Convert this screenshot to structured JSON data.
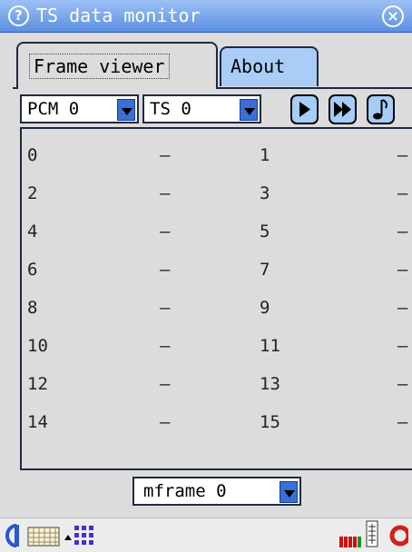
{
  "window": {
    "title": "TS data monitor",
    "help_icon": "help-circle-icon",
    "close_icon": "close-circle-icon"
  },
  "tabs": [
    {
      "label": "Frame viewer",
      "active": true
    },
    {
      "label": "About",
      "active": false
    }
  ],
  "toolbar": {
    "pcm_select": {
      "value": "PCM 0"
    },
    "ts_select": {
      "value": "TS 0"
    },
    "buttons": [
      {
        "name": "play",
        "icon": "play-icon"
      },
      {
        "name": "fast-forward",
        "icon": "fast-forward-icon"
      },
      {
        "name": "music",
        "icon": "music-note-icon"
      }
    ]
  },
  "frame_rows": [
    {
      "left_index": "0",
      "left_value": "–",
      "right_index": "1",
      "right_value": "–"
    },
    {
      "left_index": "2",
      "left_value": "–",
      "right_index": "3",
      "right_value": "–"
    },
    {
      "left_index": "4",
      "left_value": "–",
      "right_index": "5",
      "right_value": "–"
    },
    {
      "left_index": "6",
      "left_value": "–",
      "right_index": "7",
      "right_value": "–"
    },
    {
      "left_index": "8",
      "left_value": "–",
      "right_index": "9",
      "right_value": "–"
    },
    {
      "left_index": "10",
      "left_value": "–",
      "right_index": "11",
      "right_value": "–"
    },
    {
      "left_index": "12",
      "left_value": "–",
      "right_index": "13",
      "right_value": "–"
    },
    {
      "left_index": "14",
      "left_value": "–",
      "right_index": "15",
      "right_value": "–"
    }
  ],
  "mframe_select": {
    "value": "mframe 0"
  },
  "taskbar": {
    "icons": [
      "start-menu-icon",
      "keyboard-icon",
      "input-method-arrow-icon",
      "keypad-grid-icon",
      "signal-strength-icon",
      "network-icon",
      "lifebuoy-icon"
    ],
    "accent_colors": {
      "signal_bars": "#cc1111",
      "signal_bar_active": "#1a8f2a",
      "lifebuoy": "#d11f1f"
    }
  }
}
